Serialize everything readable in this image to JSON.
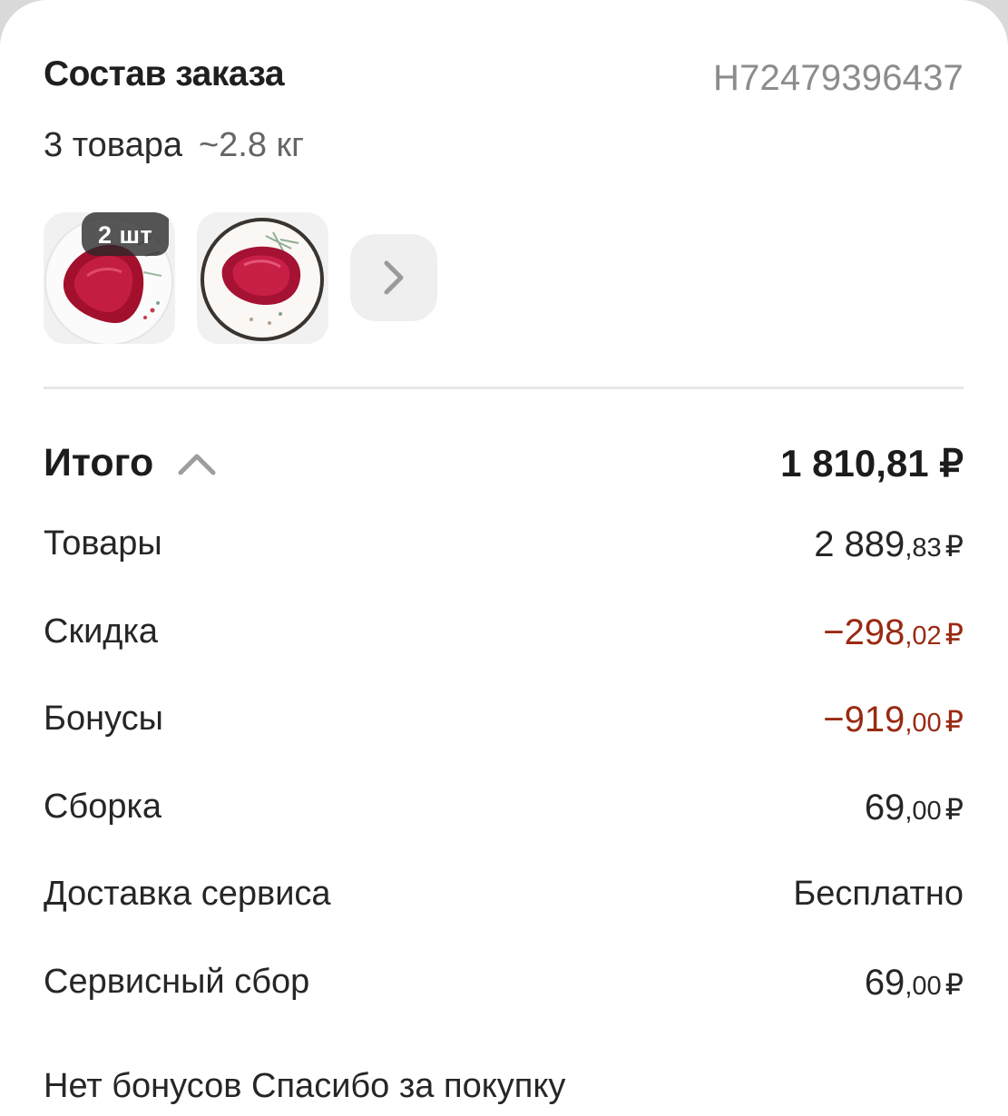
{
  "order": {
    "title": "Состав заказа",
    "id": "H72479396437",
    "items_count": "3 товара",
    "weight": "~2.8 кг",
    "thumbnails": [
      {
        "name": "meat-steak-thumbnail",
        "quantity_badge": "2 шт"
      },
      {
        "name": "meat-chunk-thumbnail"
      }
    ]
  },
  "summary": {
    "total_label": "Итого",
    "total_value": "1 810,81 ₽",
    "rows": [
      {
        "label": "Товары",
        "major": "2 889",
        "minor": ",83",
        "currency": "₽",
        "negative": false
      },
      {
        "label": "Скидка",
        "major": "−298",
        "minor": ",02",
        "currency": "₽",
        "negative": true
      },
      {
        "label": "Бонусы",
        "major": "−919",
        "minor": ",00",
        "currency": "₽",
        "negative": true
      },
      {
        "label": "Сборка",
        "major": "69",
        "minor": ",00",
        "currency": "₽",
        "negative": false
      },
      {
        "label": "Доставка сервиса",
        "text": "Бесплатно",
        "negative": false
      },
      {
        "label": "Сервисный сбор",
        "major": "69",
        "minor": ",00",
        "currency": "₽",
        "negative": false
      }
    ]
  },
  "footer": {
    "note": "Нет бонусов Спасибо за покупку"
  },
  "colors": {
    "negative": "#9a2a12",
    "muted": "#8c8c8c",
    "text": "#1f1f1f"
  },
  "icons": {
    "more": "chevron-right-icon",
    "collapse": "chevron-up-icon"
  }
}
